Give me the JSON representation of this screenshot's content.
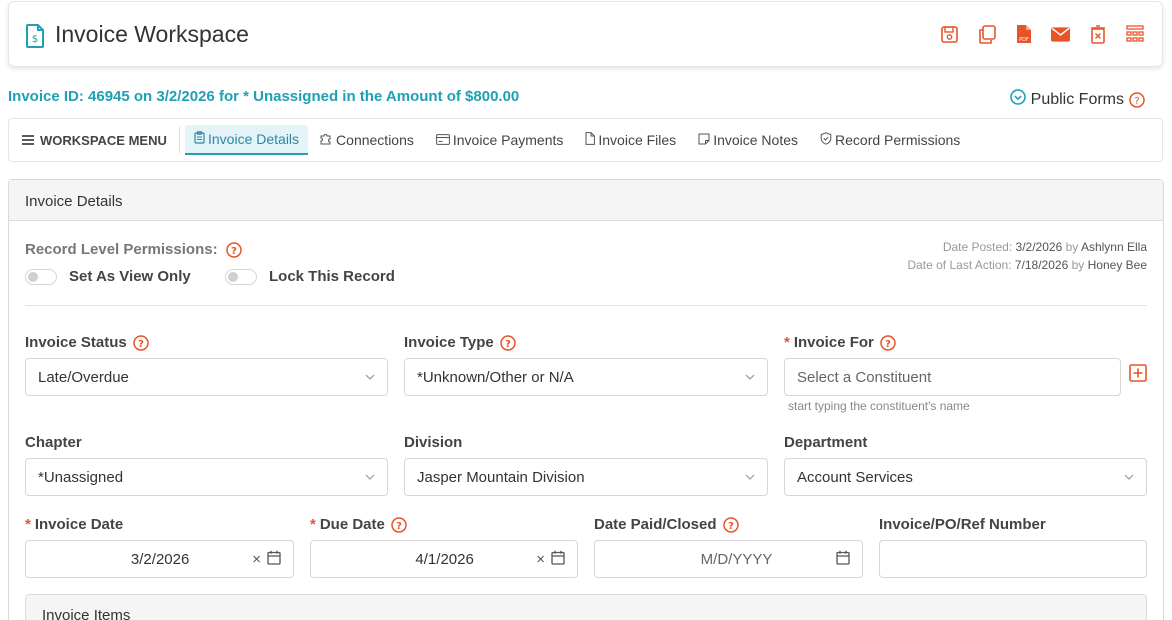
{
  "header": {
    "title": "Invoice Workspace",
    "title_icon": "invoice-dollar-icon",
    "toolbar": [
      {
        "name": "save-icon"
      },
      {
        "name": "copy-icon"
      },
      {
        "name": "pdf-icon"
      },
      {
        "name": "email-icon"
      },
      {
        "name": "delete-icon"
      },
      {
        "name": "grid-menu-icon"
      }
    ],
    "accent_color": "#e8542a"
  },
  "invoice_summary": "Invoice ID: 46945 on 3/2/2026 for * Unassigned in the Amount of $800.00",
  "public_forms": {
    "label": "Public Forms"
  },
  "workspace_menu": {
    "toggle_label": "WORKSPACE MENU",
    "tabs": [
      {
        "label": "Invoice Details",
        "icon": "clipboard-icon",
        "active": true
      },
      {
        "label": "Connections",
        "icon": "puzzle-icon"
      },
      {
        "label": "Invoice Payments",
        "icon": "card-icon"
      },
      {
        "label": "Invoice Files",
        "icon": "file-icon"
      },
      {
        "label": "Invoice Notes",
        "icon": "note-icon"
      },
      {
        "label": "Record Permissions",
        "icon": "shield-icon"
      }
    ]
  },
  "panel": {
    "title": "Invoice Details",
    "permissions": {
      "label": "Record Level Permissions:",
      "view_only": {
        "label": "Set As View Only",
        "on": false
      },
      "lock": {
        "label": "Lock This Record",
        "on": false
      }
    },
    "meta": {
      "posted_prefix": "Date Posted:",
      "posted_date": "3/2/2026",
      "posted_by_word": "by",
      "posted_by": "Ashlynn Ella",
      "last_action_prefix": "Date of Last Action:",
      "last_action_date": "7/18/2026",
      "last_action_by_word": "by",
      "last_action_by": "Honey Bee"
    },
    "fields": {
      "invoice_status": {
        "label": "Invoice Status",
        "value": "Late/Overdue"
      },
      "invoice_type": {
        "label": "Invoice Type",
        "value": "*Unknown/Other or N/A"
      },
      "invoice_for": {
        "label": "Invoice For",
        "placeholder": "Select a Constituent",
        "help": "start typing the constituent's name"
      },
      "chapter": {
        "label": "Chapter",
        "value": "*Unassigned"
      },
      "division": {
        "label": "Division",
        "value": "Jasper Mountain Division"
      },
      "department": {
        "label": "Department",
        "value": "Account Services"
      },
      "invoice_date": {
        "label": "Invoice Date",
        "value": "3/2/2026"
      },
      "due_date": {
        "label": "Due Date",
        "value": "4/1/2026"
      },
      "date_paid": {
        "label": "Date Paid/Closed",
        "placeholder": "M/D/YYYY"
      },
      "ref_number": {
        "label": "Invoice/PO/Ref Number",
        "value": ""
      }
    },
    "items_title": "Invoice Items",
    "required_mark": "*"
  }
}
